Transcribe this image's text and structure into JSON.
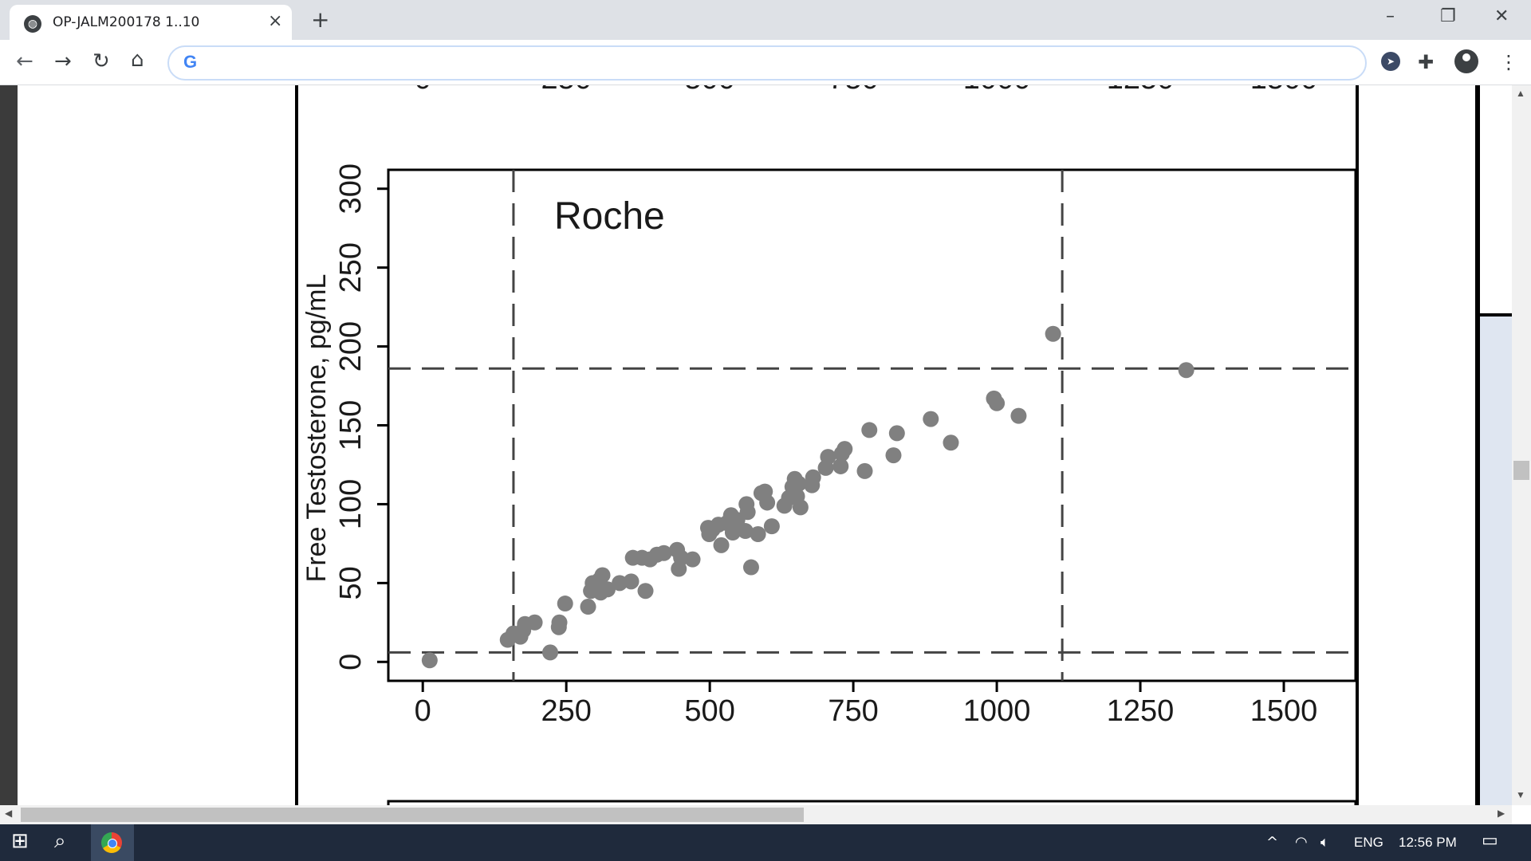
{
  "browser": {
    "tab_title": "OP-JALM200178 1..10",
    "address_value": "",
    "tab_close_glyph": "×",
    "new_tab_glyph": "+",
    "minimize_glyph": "–",
    "restore_glyph": "❐",
    "close_glyph": "✕",
    "back_glyph": "←",
    "forward_glyph": "→",
    "reload_glyph": "↻",
    "home_glyph": "⌂",
    "search_engine_glyph": "G",
    "extensions_glyph": "✚",
    "menu_glyph": "⋮"
  },
  "taskbar": {
    "language": "ENG",
    "time": "12:56 PM"
  },
  "chart_data": {
    "type": "scatter",
    "annotation": "Roche",
    "ylabel": "Free Testosterone, pg/mL",
    "xlabel": "",
    "xlim": [
      -60,
      1625
    ],
    "ylim": [
      -12,
      312
    ],
    "xticks": [
      0,
      250,
      500,
      750,
      1000,
      1250,
      1500
    ],
    "yticks": [
      0,
      50,
      100,
      150,
      200,
      250,
      300
    ],
    "reference_lines": {
      "x": [
        158,
        1114
      ],
      "y": [
        6,
        186
      ]
    },
    "marker_color": "#808080",
    "points": [
      [
        12,
        1
      ],
      [
        148,
        14
      ],
      [
        158,
        18
      ],
      [
        170,
        16
      ],
      [
        175,
        20
      ],
      [
        178,
        24
      ],
      [
        195,
        25
      ],
      [
        222,
        6
      ],
      [
        237,
        22
      ],
      [
        238,
        25
      ],
      [
        248,
        37
      ],
      [
        288,
        35
      ],
      [
        293,
        45
      ],
      [
        296,
        50
      ],
      [
        308,
        52
      ],
      [
        310,
        44
      ],
      [
        313,
        55
      ],
      [
        322,
        46
      ],
      [
        343,
        50
      ],
      [
        363,
        51
      ],
      [
        366,
        66
      ],
      [
        382,
        66
      ],
      [
        388,
        45
      ],
      [
        396,
        65
      ],
      [
        408,
        68
      ],
      [
        420,
        69
      ],
      [
        443,
        71
      ],
      [
        446,
        59
      ],
      [
        450,
        66
      ],
      [
        470,
        65
      ],
      [
        497,
        85
      ],
      [
        499,
        81
      ],
      [
        505,
        84
      ],
      [
        515,
        87
      ],
      [
        520,
        74
      ],
      [
        530,
        88
      ],
      [
        537,
        93
      ],
      [
        540,
        82
      ],
      [
        548,
        90
      ],
      [
        562,
        83
      ],
      [
        564,
        100
      ],
      [
        566,
        95
      ],
      [
        572,
        60
      ],
      [
        584,
        81
      ],
      [
        590,
        107
      ],
      [
        596,
        108
      ],
      [
        600,
        101
      ],
      [
        608,
        86
      ],
      [
        630,
        99
      ],
      [
        638,
        104
      ],
      [
        644,
        111
      ],
      [
        648,
        116
      ],
      [
        652,
        105
      ],
      [
        655,
        113
      ],
      [
        658,
        98
      ],
      [
        678,
        112
      ],
      [
        680,
        117
      ],
      [
        702,
        123
      ],
      [
        706,
        130
      ],
      [
        728,
        124
      ],
      [
        730,
        132
      ],
      [
        735,
        135
      ],
      [
        770,
        121
      ],
      [
        778,
        147
      ],
      [
        820,
        131
      ],
      [
        826,
        145
      ],
      [
        885,
        154
      ],
      [
        920,
        139
      ],
      [
        995,
        167
      ],
      [
        1000,
        164
      ],
      [
        1038,
        156
      ],
      [
        1098,
        208
      ],
      [
        1330,
        185
      ]
    ]
  }
}
